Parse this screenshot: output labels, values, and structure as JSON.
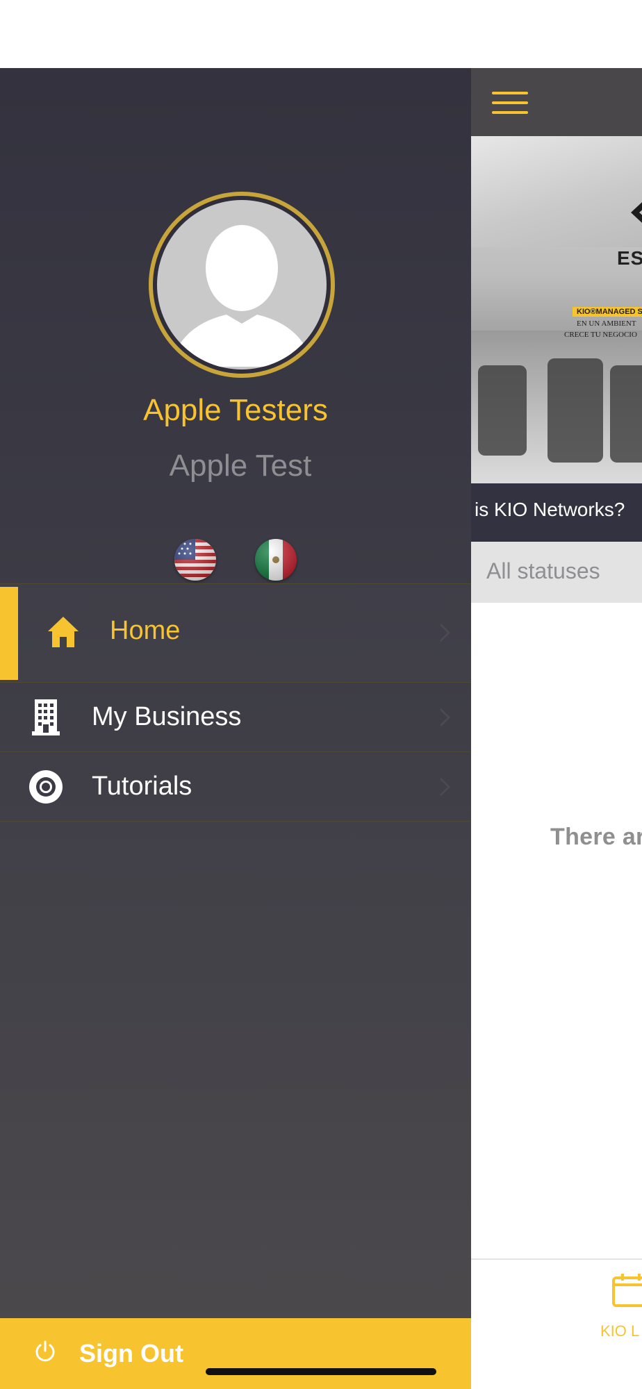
{
  "drawer": {
    "user_name": "Apple Testers",
    "user_subtitle": "Apple Test",
    "languages": [
      {
        "code": "en",
        "flag": "us-flag-icon"
      },
      {
        "code": "es",
        "flag": "mexico-flag-icon"
      }
    ],
    "menu": [
      {
        "label": "Home",
        "icon": "home-icon",
        "active": true
      },
      {
        "label": "My Business",
        "icon": "building-icon",
        "active": false
      },
      {
        "label": "Tutorials",
        "icon": "lifebuoy-icon",
        "active": false
      }
    ],
    "sign_out_label": "Sign Out"
  },
  "main": {
    "banner": {
      "es_text": "ES.",
      "tag_text": "KIO®MANAGED S",
      "line1": "EN UN AMBIENT",
      "line2": "CRECE TU NEGOCIO"
    },
    "caption": "is KIO Networks?",
    "filter_label": "All statuses",
    "empty_text": "There ar",
    "tab_label": "KIO L"
  },
  "colors": {
    "accent": "#f7c430",
    "drawer_top": "#33323e",
    "drawer_bottom": "#4d4a4d",
    "header": "#4a474b",
    "caption_bg": "#323240"
  }
}
